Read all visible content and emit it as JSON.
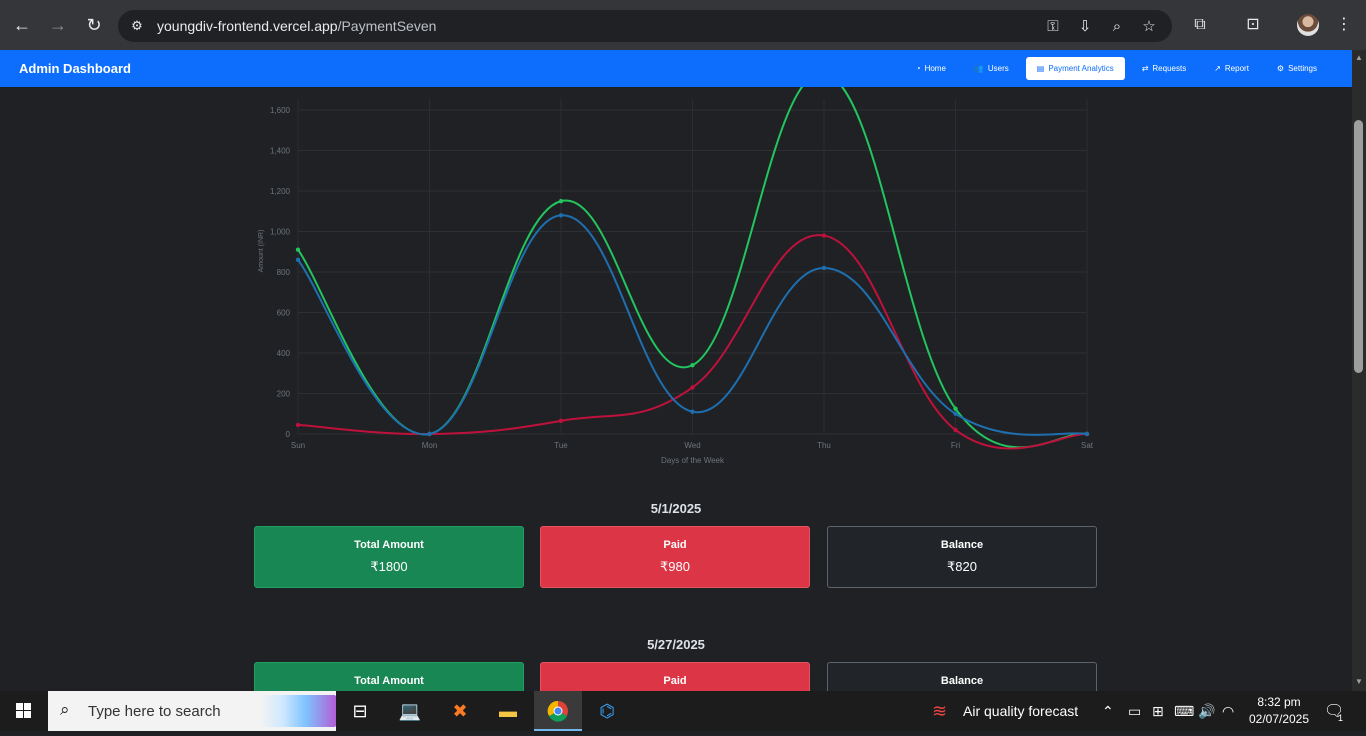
{
  "browser": {
    "url_domain": "youngdiv-frontend.vercel.app",
    "url_path": "/PaymentSeven"
  },
  "navbar": {
    "brand": "Admin Dashboard",
    "links": [
      {
        "label": "Home",
        "icon": "dashboard-icon",
        "active": false
      },
      {
        "label": "Users",
        "icon": "users-icon",
        "active": false
      },
      {
        "label": "Payment Analytics",
        "icon": "table-icon",
        "active": true
      },
      {
        "label": "Requests",
        "icon": "exchange-icon",
        "active": false
      },
      {
        "label": "Report",
        "icon": "chart-icon",
        "active": false
      },
      {
        "label": "Settings",
        "icon": "gear-icon",
        "active": false
      }
    ],
    "color": "#0d6efd"
  },
  "chart_data": {
    "type": "line",
    "categories": [
      "Sun",
      "Mon",
      "Tue",
      "Wed",
      "Thu",
      "Fri",
      "Sat"
    ],
    "xlabel": "Days of the Week",
    "ylabel": "Amount (INR)",
    "ylim": [
      0,
      1800
    ],
    "yticks": [
      0,
      200,
      400,
      600,
      800,
      1000,
      1200,
      1400,
      1600
    ],
    "ytick_labels": [
      "0",
      "200",
      "400",
      "600",
      "800",
      "1,000",
      "1,200",
      "1,400",
      "1,600"
    ],
    "grid": true,
    "series": [
      {
        "color": "#22c55e",
        "values": [
          910,
          0,
          1150,
          340,
          1780,
          125,
          0
        ]
      },
      {
        "color": "#be123c",
        "values": [
          45,
          0,
          65,
          230,
          980,
          20,
          0
        ]
      },
      {
        "color": "#1e6fb0",
        "values": [
          860,
          0,
          1080,
          110,
          820,
          100,
          0
        ]
      }
    ]
  },
  "sections": [
    {
      "date": "5/1/2025",
      "cards": [
        {
          "label": "Total Amount",
          "value": "₹1800"
        },
        {
          "label": "Paid",
          "value": "₹980"
        },
        {
          "label": "Balance",
          "value": "₹820"
        }
      ]
    },
    {
      "date": "5/27/2025",
      "cards": [
        {
          "label": "Total Amount",
          "value": ""
        },
        {
          "label": "Paid",
          "value": ""
        },
        {
          "label": "Balance",
          "value": ""
        }
      ]
    }
  ],
  "taskbar": {
    "search_placeholder": "Type here to search",
    "weather": "Air quality forecast",
    "time": "8:32 pm",
    "date": "02/07/2025",
    "notifications": "1"
  }
}
